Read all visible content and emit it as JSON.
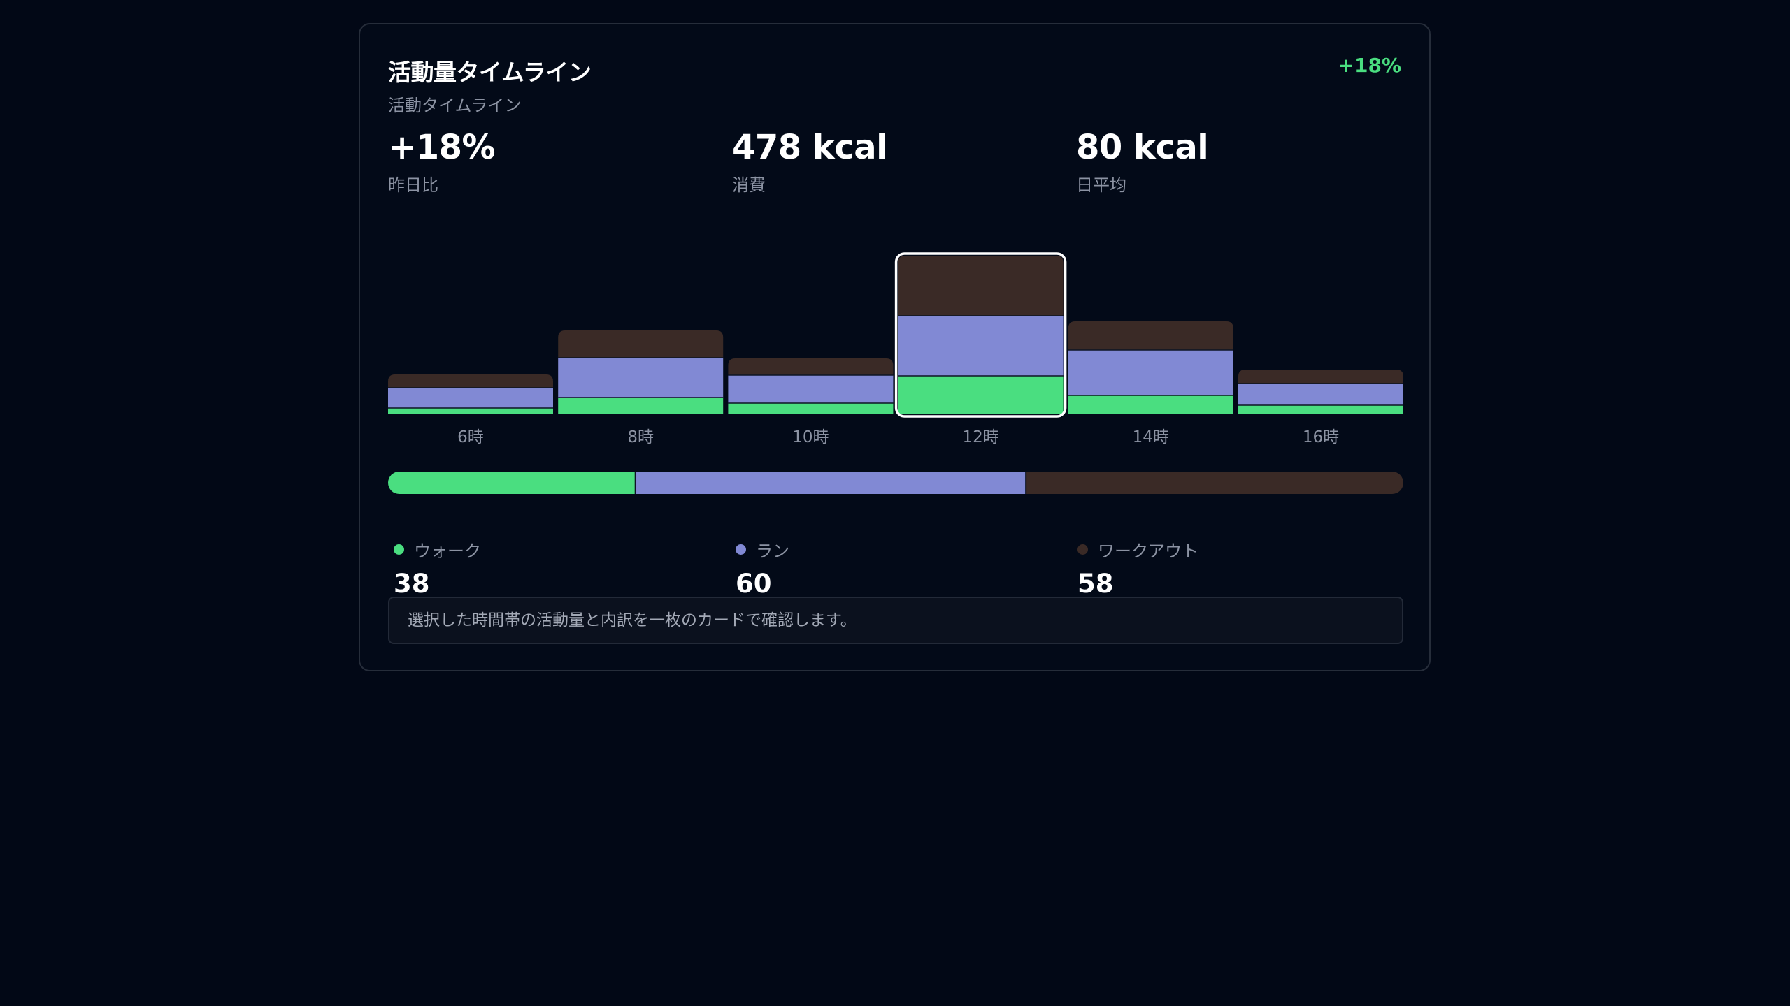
{
  "card": {
    "title": "活動量タイムライン",
    "subtitle": "活動タイムライン",
    "badge": "+18%"
  },
  "stats": [
    {
      "value": "+18%",
      "label": "昨日比"
    },
    {
      "value": "478 kcal",
      "label": "消費"
    },
    {
      "value": "80 kcal",
      "label": "日平均"
    }
  ],
  "colors": {
    "walk": "#4ade80",
    "run": "#8189d4",
    "workout": "#3a2a26",
    "selected_outline": "#ffffff"
  },
  "chart_data": {
    "type": "bar",
    "stacked": true,
    "categories": [
      "6時",
      "8時",
      "10時",
      "12時",
      "14時",
      "16時"
    ],
    "series": [
      {
        "name": "ウォーク",
        "values": [
          9,
          24,
          16,
          55,
          27,
          13
        ]
      },
      {
        "name": "ラン",
        "values": [
          29,
          57,
          40,
          86,
          65,
          31
        ]
      },
      {
        "name": "ワークアウト",
        "values": [
          19,
          39,
          24,
          86,
          41,
          20
        ]
      }
    ],
    "selected_category": "12時",
    "ylim": [
      0,
      230
    ],
    "grid": false,
    "legend": "bottom"
  },
  "breakdown": {
    "items": [
      {
        "name": "ウォーク",
        "value": "38",
        "share": 38
      },
      {
        "name": "ラン",
        "value": "60",
        "share": 60
      },
      {
        "name": "ワークアウト",
        "value": "58",
        "share": 58
      }
    ]
  },
  "note": "選択した時間帯の活動量と内訳を一枚のカードで確認します。"
}
